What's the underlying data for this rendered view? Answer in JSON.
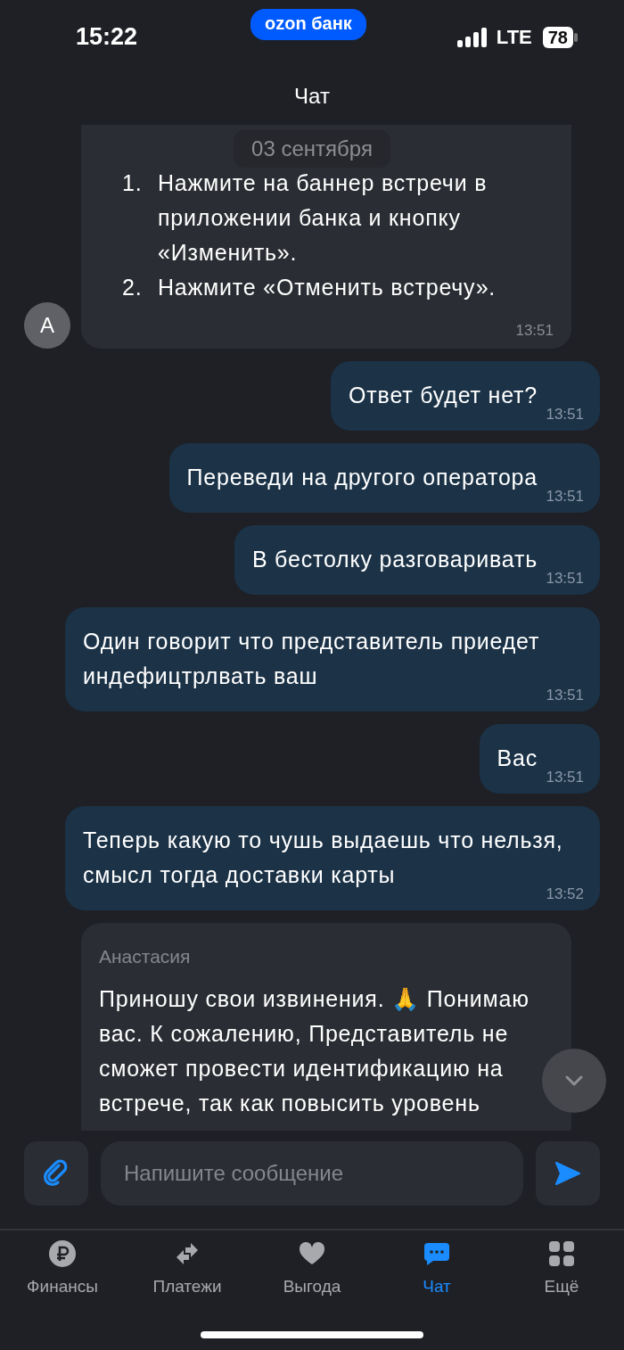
{
  "status_bar": {
    "time": "15:22",
    "badge": "ozon банк",
    "network": "LTE",
    "battery": "78"
  },
  "header": {
    "title": "Чат"
  },
  "date_separator": "03 сентября",
  "messages": [
    {
      "kind": "incoming_list",
      "avatar": "А",
      "items": [
        {
          "number": "1.",
          "text": "Нажмите на баннер встречи в приложении банка и кнопку «Изменить»."
        },
        {
          "number": "2.",
          "text": "Нажмите «Отменить встречу»."
        }
      ],
      "time": "13:51"
    },
    {
      "kind": "outgoing",
      "text": "Ответ будет нет?",
      "time": "13:51"
    },
    {
      "kind": "outgoing",
      "text": "Переведи на другого оператора",
      "time": "13:51"
    },
    {
      "kind": "outgoing",
      "text": "В бестолку разговаривать",
      "time": "13:51"
    },
    {
      "kind": "outgoing",
      "text": "Один говорит что представитель приедет индефицтрлвать ваш",
      "time": "13:51"
    },
    {
      "kind": "outgoing",
      "text": "Вас",
      "time": "13:51"
    },
    {
      "kind": "outgoing",
      "text": "Теперь какую то чушь выдаешь что нельзя, смысл тогда доставки карты",
      "time": "13:52"
    },
    {
      "kind": "incoming",
      "sender": "Анастасия",
      "text": "Приношу свои извинения. 🙏 Понимаю вас. К сожалению, Представитель не сможет провести идентификацию на встрече, так как повысить уровень"
    }
  ],
  "composer": {
    "placeholder": "Напишите сообщение"
  },
  "tabs": [
    {
      "label": "Финансы",
      "selected": false
    },
    {
      "label": "Платежи",
      "selected": false
    },
    {
      "label": "Выгода",
      "selected": false
    },
    {
      "label": "Чат",
      "selected": true
    },
    {
      "label": "Ещё",
      "selected": false
    }
  ]
}
